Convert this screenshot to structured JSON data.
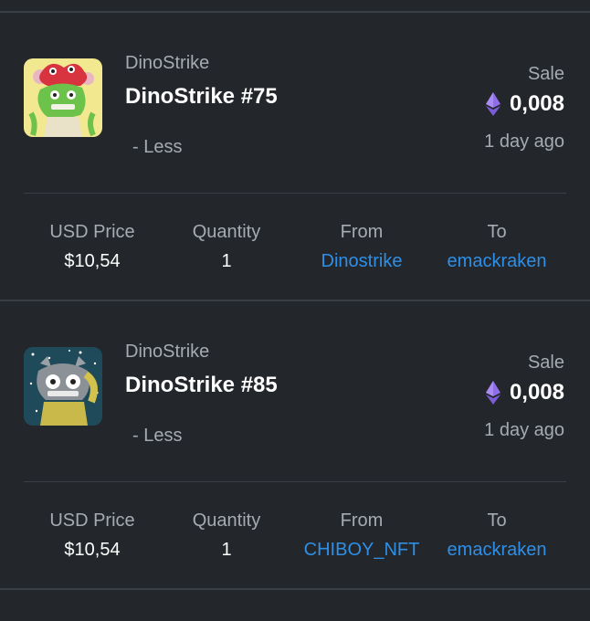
{
  "colors": {
    "background": "#23272c",
    "divider": "#3a3f45",
    "muted": "#a6abb1",
    "link": "#2f8fe6",
    "eth": "#8f6ee8"
  },
  "activity": [
    {
      "collection": "DinoStrike",
      "name": "DinoStrike #75",
      "toggle": "- Less",
      "event": "Sale",
      "price": "0,008",
      "currency_icon": "ethereum-icon",
      "time": "1 day ago",
      "labels": {
        "usd": "USD Price",
        "quantity": "Quantity",
        "from": "From",
        "to": "To"
      },
      "usd_price": "$10,54",
      "quantity": "1",
      "from": "Dinostrike",
      "to": "emackraken"
    },
    {
      "collection": "DinoStrike",
      "name": "DinoStrike #85",
      "toggle": "- Less",
      "event": "Sale",
      "price": "0,008",
      "currency_icon": "ethereum-icon",
      "time": "1 day ago",
      "labels": {
        "usd": "USD Price",
        "quantity": "Quantity",
        "from": "From",
        "to": "To"
      },
      "usd_price": "$10,54",
      "quantity": "1",
      "from": "CHIBOY_NFT",
      "to": "emackraken"
    }
  ]
}
